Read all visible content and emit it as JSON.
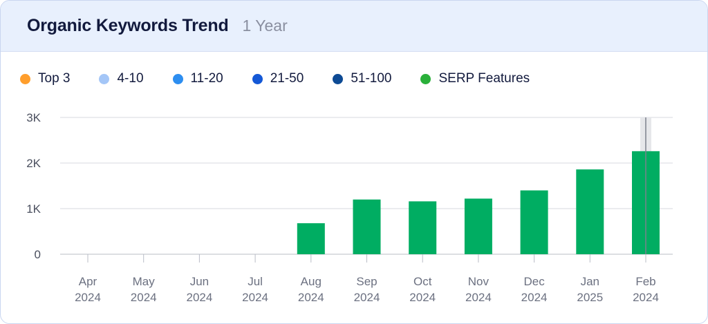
{
  "header": {
    "title": "Organic Keywords Trend",
    "period": "1 Year"
  },
  "legend": [
    {
      "label": "Top 3",
      "color": "#ff9e2c"
    },
    {
      "label": "4-10",
      "color": "#a4c6f7"
    },
    {
      "label": "11-20",
      "color": "#2d8ef0"
    },
    {
      "label": "21-50",
      "color": "#1458d6"
    },
    {
      "label": "51-100",
      "color": "#0d4a94"
    },
    {
      "label": "SERP Features",
      "color": "#2ab03a"
    }
  ],
  "chart_data": {
    "type": "bar",
    "categories": [
      [
        "Apr",
        "2024"
      ],
      [
        "May",
        "2024"
      ],
      [
        "Jun",
        "2024"
      ],
      [
        "Jul",
        "2024"
      ],
      [
        "Aug",
        "2024"
      ],
      [
        "Sep",
        "2024"
      ],
      [
        "Oct",
        "2024"
      ],
      [
        "Nov",
        "2024"
      ],
      [
        "Dec",
        "2024"
      ],
      [
        "Jan",
        "2025"
      ],
      [
        "Feb",
        "2024"
      ]
    ],
    "series": [
      {
        "values": [
          0,
          0,
          0,
          0,
          680,
          1200,
          1160,
          1220,
          1400,
          1860,
          2260
        ],
        "color": "#00ad62"
      }
    ],
    "y_ticks": [
      {
        "value": 0,
        "label": "0"
      },
      {
        "value": 1000,
        "label": "1K"
      },
      {
        "value": 2000,
        "label": "2K"
      },
      {
        "value": 3000,
        "label": "3K"
      }
    ],
    "ylim": [
      0,
      3000
    ],
    "grid": true,
    "highlighted_category": 10
  }
}
